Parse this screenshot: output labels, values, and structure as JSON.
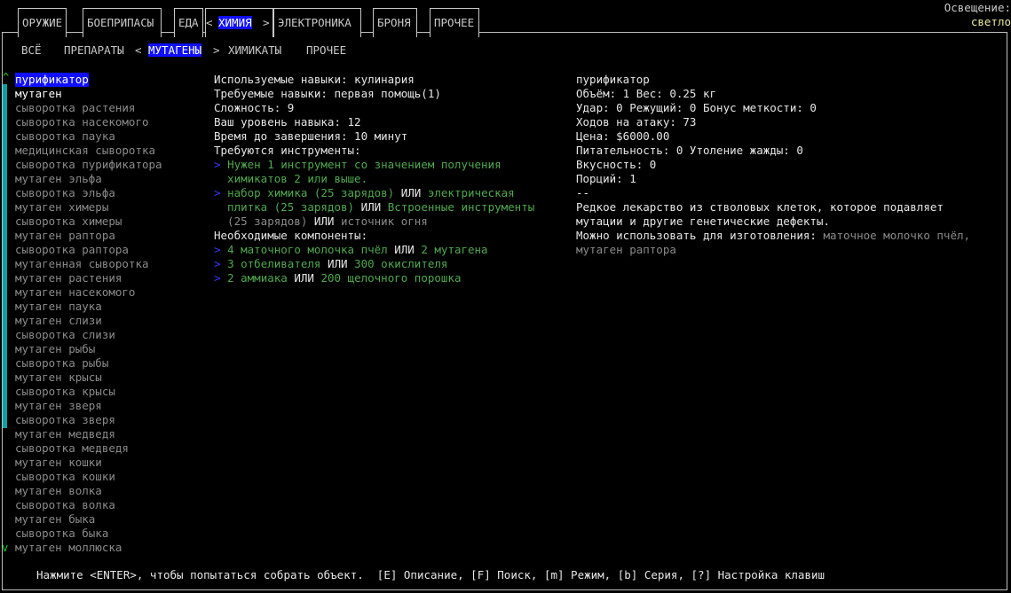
{
  "top_tabs": [
    {
      "label": "ОРУЖИЕ",
      "active": false
    },
    {
      "label": "БОЕПРИПАСЫ",
      "active": false
    },
    {
      "label": "ЕДА",
      "active": false
    },
    {
      "label": "ХИМИЯ",
      "active": true
    },
    {
      "label": "ЭЛЕКТРОНИКА",
      "active": false
    },
    {
      "label": "БРОНЯ",
      "active": false
    },
    {
      "label": "ПРОЧЕЕ",
      "active": false
    }
  ],
  "light": {
    "title": "Освещение:",
    "value": "светло"
  },
  "sub_tabs": [
    {
      "label": "ВСЁ",
      "active": false
    },
    {
      "label": "ПРЕПАРАТЫ",
      "active": false
    },
    {
      "label": "МУТАГЕНЫ",
      "active": true
    },
    {
      "label": "ХИМИКАТЫ",
      "active": false
    },
    {
      "label": "ПРОЧЕЕ",
      "active": false
    }
  ],
  "arrows": {
    "left": "<",
    "right": ">",
    "up": "^",
    "down": "v"
  },
  "recipes": [
    {
      "name": "пурификатор",
      "state": "selected"
    },
    {
      "name": "мутаген",
      "state": "bright"
    },
    {
      "name": "сыворотка растения",
      "state": "dim"
    },
    {
      "name": "сыворотка насекомого",
      "state": "dim"
    },
    {
      "name": "сыворотка паука",
      "state": "dim"
    },
    {
      "name": "медицинская сыворотка",
      "state": "dim"
    },
    {
      "name": "сыворотка пурификатора",
      "state": "dim"
    },
    {
      "name": "мутаген эльфа",
      "state": "dim"
    },
    {
      "name": "сыворотка эльфа",
      "state": "dim"
    },
    {
      "name": "мутаген химеры",
      "state": "dim"
    },
    {
      "name": "сыворотка химеры",
      "state": "dim"
    },
    {
      "name": "мутаген раптора",
      "state": "dim"
    },
    {
      "name": "сыворотка раптора",
      "state": "dim"
    },
    {
      "name": "мутагенная сыворотка",
      "state": "dim"
    },
    {
      "name": "мутаген растения",
      "state": "dim"
    },
    {
      "name": "мутаген насекомого",
      "state": "dim"
    },
    {
      "name": "мутаген паука",
      "state": "dim"
    },
    {
      "name": "мутаген слизи",
      "state": "dim"
    },
    {
      "name": "сыворотка слизи",
      "state": "dim"
    },
    {
      "name": "мутаген рыбы",
      "state": "dim"
    },
    {
      "name": "сыворотка рыбы",
      "state": "dim"
    },
    {
      "name": "мутаген крысы",
      "state": "dim"
    },
    {
      "name": "сыворотка крысы",
      "state": "dim"
    },
    {
      "name": "мутаген зверя",
      "state": "dim"
    },
    {
      "name": "сыворотка зверя",
      "state": "dim"
    },
    {
      "name": "мутаген медведя",
      "state": "dim"
    },
    {
      "name": "сыворотка медведя",
      "state": "dim"
    },
    {
      "name": "мутаген кошки",
      "state": "dim"
    },
    {
      "name": "сыворотка кошки",
      "state": "dim"
    },
    {
      "name": "мутаген волка",
      "state": "dim"
    },
    {
      "name": "сыворотка волка",
      "state": "dim"
    },
    {
      "name": "мутаген быка",
      "state": "dim"
    },
    {
      "name": "сыворотка быка",
      "state": "dim"
    },
    {
      "name": "мутаген моллюска",
      "state": "dim"
    }
  ],
  "requirements": [
    [
      {
        "t": "Используемые навыки: кулинария",
        "c": "w"
      }
    ],
    [
      {
        "t": "Требуемые навыки: первая помощь(1)",
        "c": "w"
      }
    ],
    [
      {
        "t": "Сложность: 9",
        "c": "w"
      }
    ],
    [
      {
        "t": "Ваш уровень навыка: 12",
        "c": "w"
      }
    ],
    [
      {
        "t": "Время до завершения: 10 минут",
        "c": "w"
      }
    ],
    [
      {
        "t": "Требуются инструменты:",
        "c": "w"
      }
    ],
    [
      {
        "t": "> ",
        "c": "arr"
      },
      {
        "t": "Нужен 1 инструмент со значением получения",
        "c": "g"
      }
    ],
    [
      {
        "t": "  химикатов 2 или выше.",
        "c": "g"
      }
    ],
    [
      {
        "t": "> ",
        "c": "arr"
      },
      {
        "t": "набор химика (25 зарядов)",
        "c": "g"
      },
      {
        "t": " ИЛИ ",
        "c": "w"
      },
      {
        "t": "электрическая",
        "c": "g"
      }
    ],
    [
      {
        "t": "  плитка (25 зарядов)",
        "c": "g"
      },
      {
        "t": " ИЛИ ",
        "c": "w"
      },
      {
        "t": "Встроенные инструменты",
        "c": "g"
      }
    ],
    [
      {
        "t": "  (25 зарядов)",
        "c": "gray"
      },
      {
        "t": " ИЛИ ",
        "c": "w"
      },
      {
        "t": "источник огня",
        "c": "gray"
      }
    ],
    [
      {
        "t": "Необходимые компоненты:",
        "c": "w"
      }
    ],
    [
      {
        "t": "> ",
        "c": "arr"
      },
      {
        "t": "4 маточного молочка пчёл",
        "c": "g"
      },
      {
        "t": " ИЛИ ",
        "c": "w"
      },
      {
        "t": "2 мутагена",
        "c": "g"
      }
    ],
    [
      {
        "t": "> ",
        "c": "arr"
      },
      {
        "t": "3 отбеливателя",
        "c": "g"
      },
      {
        "t": " ИЛИ ",
        "c": "w"
      },
      {
        "t": "300 окислителя",
        "c": "g"
      }
    ],
    [
      {
        "t": "> ",
        "c": "arr"
      },
      {
        "t": "2 аммиака",
        "c": "g"
      },
      {
        "t": " ИЛИ ",
        "c": "w"
      },
      {
        "t": "200 щелочного порошка",
        "c": "g"
      }
    ]
  ],
  "item_info": [
    [
      {
        "t": "пурификатор",
        "c": "w"
      }
    ],
    [
      {
        "t": "Объём: 1 Вес: 0.25 кг",
        "c": "w"
      }
    ],
    [
      {
        "t": "Удар: 0 Режущий: 0 Бонус меткости: 0",
        "c": "w"
      }
    ],
    [
      {
        "t": "Ходов на атаку: 73",
        "c": "w"
      }
    ],
    [
      {
        "t": "Цена: $6000.00",
        "c": "w"
      }
    ],
    [
      {
        "t": "Питательность: 0 Утоление жажды: 0",
        "c": "w"
      }
    ],
    [
      {
        "t": "Вкусность: 0",
        "c": "w"
      }
    ],
    [
      {
        "t": "Порций: 1",
        "c": "w"
      }
    ],
    [
      {
        "t": "--",
        "c": "w"
      }
    ],
    [
      {
        "t": "Редкое лекарство из стволовых клеток, которое подавляет",
        "c": "w"
      }
    ],
    [
      {
        "t": "мутации и другие генетические дефекты.",
        "c": "w"
      }
    ],
    [
      {
        "t": "Можно использовать для изготовления: ",
        "c": "w"
      },
      {
        "t": "маточное молочко пчёл,",
        "c": "gray"
      }
    ],
    [
      {
        "t": "мутаген раптора",
        "c": "gray"
      }
    ]
  ],
  "footer": "Нажмите <ENTER>, чтобы попытаться собрать объект.  [E] Описание, [F] Поиск, [m] Режим, [b] Серия, [?] Настройка клавиш",
  "colors": {
    "highlight": "#1010ff",
    "green": "#4fa84f",
    "dim": "#8a8a8a",
    "scrollbar": "#0aa0a8"
  }
}
